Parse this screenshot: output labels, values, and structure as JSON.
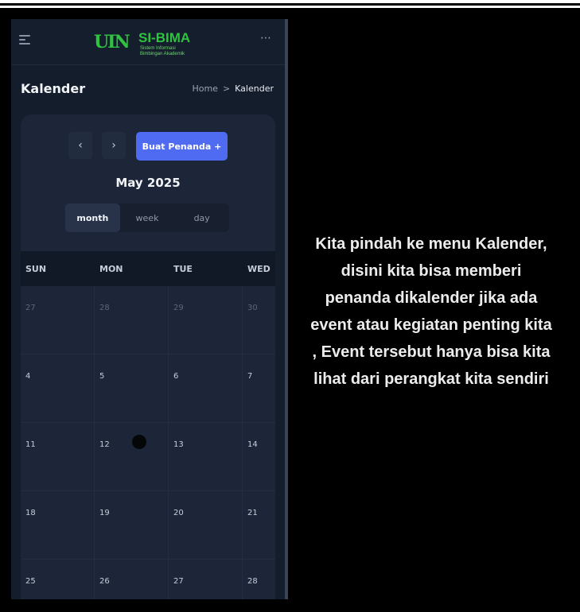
{
  "header": {
    "logo_mark": "UIN",
    "logo_title": "SI-BIMA",
    "logo_sub1": "Sistem Informasi",
    "logo_sub2": "Bimbingan Akademik",
    "more_label": "⋯"
  },
  "page": {
    "title": "Kalender",
    "breadcrumb": {
      "home": "Home",
      "separator": ">",
      "current": "Kalender"
    }
  },
  "calendar": {
    "prev_label": "‹",
    "next_label": "›",
    "create_label": "Buat Penanda +",
    "month_title": "May 2025",
    "views": [
      "month",
      "week",
      "day"
    ],
    "active_view": "month",
    "weekday_headers": [
      "SUN",
      "MON",
      "TUE",
      "WED"
    ],
    "weeks": [
      [
        "27",
        "28",
        "29",
        "30"
      ],
      [
        "4",
        "5",
        "6",
        "7"
      ],
      [
        "11",
        "12",
        "13",
        "14"
      ],
      [
        "18",
        "19",
        "20",
        "21"
      ],
      [
        "25",
        "26",
        "27",
        "28"
      ]
    ]
  },
  "caption": {
    "lines": [
      "Kita pindah ke menu Kalender,",
      "disini kita bisa memberi",
      "penanda dikalender jika ada",
      "event atau kegiatan penting kita",
      ", Event tersebut hanya bisa kita",
      "lihat dari perangkat kita sendiri"
    ]
  },
  "colors": {
    "brand_green": "#2ec440",
    "primary_button": "#4f6bf2",
    "background": "#141d2c"
  }
}
